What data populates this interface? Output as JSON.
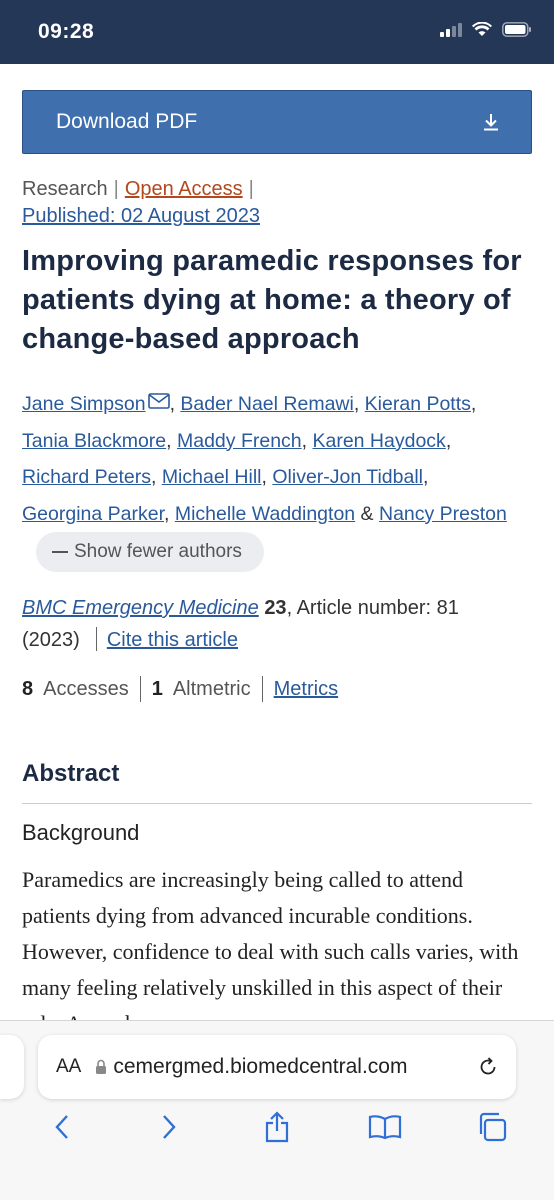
{
  "status": {
    "time": "09:28"
  },
  "download": {
    "label": "Download PDF"
  },
  "meta": {
    "type": "Research",
    "access": "Open Access",
    "published": "Published: 02 August 2023"
  },
  "title": "Improving paramedic responses for patients dying at home: a theory of change-based approach",
  "authors": {
    "list": [
      "Jane Simpson",
      "Bader Nael Remawi",
      "Kieran Potts",
      "Tania Blackmore",
      "Maddy French",
      "Karen Haydock",
      "Richard Peters",
      "Michael Hill",
      "Oliver-Jon Tidball",
      "Georgina Parker",
      "Michelle Waddington",
      "Nancy Preston"
    ],
    "show_fewer": "Show fewer authors"
  },
  "journal": {
    "name": "BMC Emergency Medicine",
    "volume": "23",
    "article": ", Article number: 81",
    "year": "(2023)",
    "cite": "Cite this article"
  },
  "stats": {
    "accesses_n": "8",
    "accesses": "Accesses",
    "altmetric_n": "1",
    "altmetric": "Altmetric",
    "metrics": "Metrics"
  },
  "abstract": {
    "heading": "Abstract",
    "subheading": "Background",
    "text": "Paramedics are increasingly being called to attend patients dying from advanced incurable conditions. However, confidence to deal with such calls varies, with many feeling relatively unskilled in this aspect of their role. A number"
  },
  "browser": {
    "aa": "AA",
    "url": "cemergmed.biomedcentral.com"
  }
}
